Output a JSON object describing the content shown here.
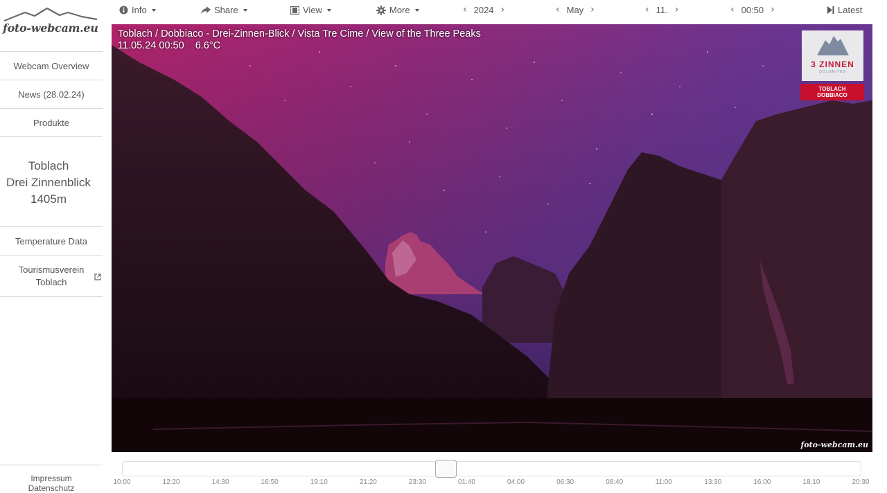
{
  "logo": {
    "text": "foto-webcam.eu"
  },
  "sidebar": {
    "nav": [
      {
        "label": "Webcam Overview"
      },
      {
        "label": "News (28.02.24)"
      },
      {
        "label": "Produkte"
      }
    ],
    "cam_title": {
      "line1": "Toblach",
      "line2": "Drei Zinnenblick",
      "line3": "1405m"
    },
    "links": [
      {
        "label": "Temperature Data"
      },
      {
        "label_line1": "Tourismusverein",
        "label_line2": "Toblach",
        "icon": "external-link-icon"
      }
    ],
    "footer": {
      "impressum": "Impressum",
      "datenschutz": "Datenschutz"
    }
  },
  "toolbar": {
    "info": {
      "label": "Info",
      "icon": "info-circle-icon"
    },
    "share": {
      "label": "Share",
      "icon": "share-arrow-icon"
    },
    "view": {
      "label": "View",
      "icon": "film-icon"
    },
    "more": {
      "label": "More",
      "icon": "gear-icon"
    },
    "year": "2024",
    "month": "May",
    "day": "11.",
    "time": "00:50",
    "latest": {
      "label": "Latest",
      "icon": "skip-to-end-icon"
    }
  },
  "image": {
    "title": "Toblach / Dobbiaco - Drei-Zinnen-Blick / Vista Tre Cime / View of the Three Peaks",
    "datetime": "11.05.24 00:50",
    "temperature": "6.6°C",
    "badge_title": "3 ZINNEN",
    "badge_sub": "DOLOMITES",
    "badge_red_line1": "TOBLACH",
    "badge_red_line2": "DOBBIACO",
    "watermark": "foto-webcam.eu"
  },
  "timeline": {
    "position_label": "00:50",
    "ticks": [
      "10:00",
      "12:20",
      "14:30",
      "16:50",
      "19:10",
      "21:20",
      "23:30",
      "01:40",
      "04:00",
      "06:30",
      "08:40",
      "11:00",
      "13:30",
      "16:00",
      "18:10",
      "20:30"
    ]
  }
}
